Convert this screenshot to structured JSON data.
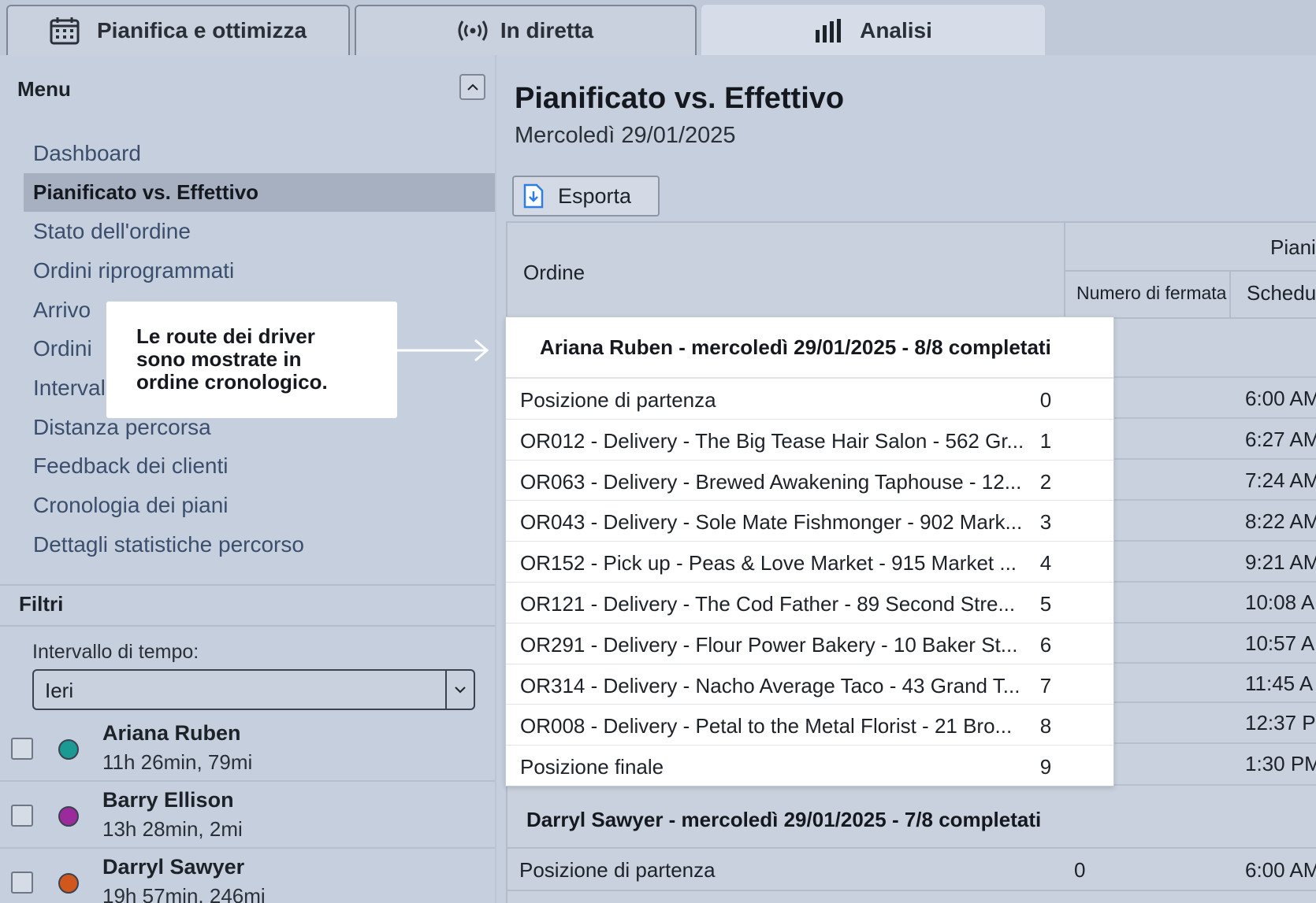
{
  "tabs": [
    {
      "label": "Pianifica e ottimizza",
      "icon": "calendar-icon"
    },
    {
      "label": "In diretta",
      "icon": "live-broadcast-icon"
    },
    {
      "label": "Analisi",
      "icon": "bar-chart-icon"
    }
  ],
  "sidebar": {
    "menu_title": "Menu",
    "items": [
      {
        "label": "Dashboard"
      },
      {
        "label": "Pianificato vs. Effettivo",
        "active": true
      },
      {
        "label": "Stato dell'ordine"
      },
      {
        "label": "Ordini riprogrammati"
      },
      {
        "label": "Arrivo"
      },
      {
        "label": "Ordini"
      },
      {
        "label": "Interval"
      },
      {
        "label": "Distanza percorsa"
      },
      {
        "label": "Feedback dei clienti"
      },
      {
        "label": "Cronologia dei piani"
      },
      {
        "label": "Dettagli statistiche percorso"
      }
    ],
    "filters_title": "Filtri",
    "interval_label": "Intervallo di tempo:",
    "interval_value": "Ieri",
    "drivers": [
      {
        "name": "Ariana Ruben",
        "stats": "11h 26min, 79mi",
        "color": "#1a9a93"
      },
      {
        "name": "Barry Ellison",
        "stats": "13h 28min, 2mi",
        "color": "#9b2a9c"
      },
      {
        "name": "Darryl Sawyer",
        "stats": "19h 57min, 246mi",
        "color": "#d2571c"
      }
    ]
  },
  "main": {
    "title": "Pianificato vs. Effettivo",
    "date": "Mercoledì 29/01/2025",
    "export_label": "Esporta",
    "table": {
      "col_order": "Ordine",
      "col_group": "Piani",
      "col_stop": "Numero di fermata",
      "col_sched": "Schedu"
    },
    "callout_text": "Le route dei driver sono mostrate in ordine cronologico.",
    "group1": {
      "title": "Ariana Ruben - mercoledì 29/01/2025 - 8/8 completati",
      "rows": [
        {
          "order": "Posizione di partenza",
          "stop": "0",
          "time": "6:00 AM"
        },
        {
          "order": "OR012 - Delivery - The Big Tease Hair Salon - 562 Gr...",
          "stop": "1",
          "time": "6:27 AM"
        },
        {
          "order": "OR063 - Delivery - Brewed Awakening Taphouse - 12...",
          "stop": "2",
          "time": "7:24 AM"
        },
        {
          "order": "OR043 - Delivery - Sole Mate Fishmonger - 902 Mark...",
          "stop": "3",
          "time": "8:22 AM"
        },
        {
          "order": "OR152 - Pick up - Peas & Love Market - 915 Market ...",
          "stop": "4",
          "time": "9:21 AM"
        },
        {
          "order": "OR121 - Delivery - The Cod Father - 89 Second Stre...",
          "stop": "5",
          "time": "10:08 A"
        },
        {
          "order": "OR291 - Delivery - Flour Power Bakery - 10 Baker St...",
          "stop": "6",
          "time": "10:57 A"
        },
        {
          "order": "OR314 - Delivery - Nacho Average Taco - 43 Grand T...",
          "stop": "7",
          "time": "11:45 A"
        },
        {
          "order": "OR008 - Delivery - Petal to the Metal Florist - 21 Bro...",
          "stop": "8",
          "time": "12:37 P"
        },
        {
          "order": "Posizione finale",
          "stop": "9",
          "time": "1:30 PM"
        }
      ]
    },
    "group2": {
      "title": "Darryl Sawyer - mercoledì 29/01/2025 - 7/8 completati",
      "first_row": {
        "order": "Posizione di partenza",
        "stop": "0",
        "time": "6:00 AM"
      }
    }
  }
}
